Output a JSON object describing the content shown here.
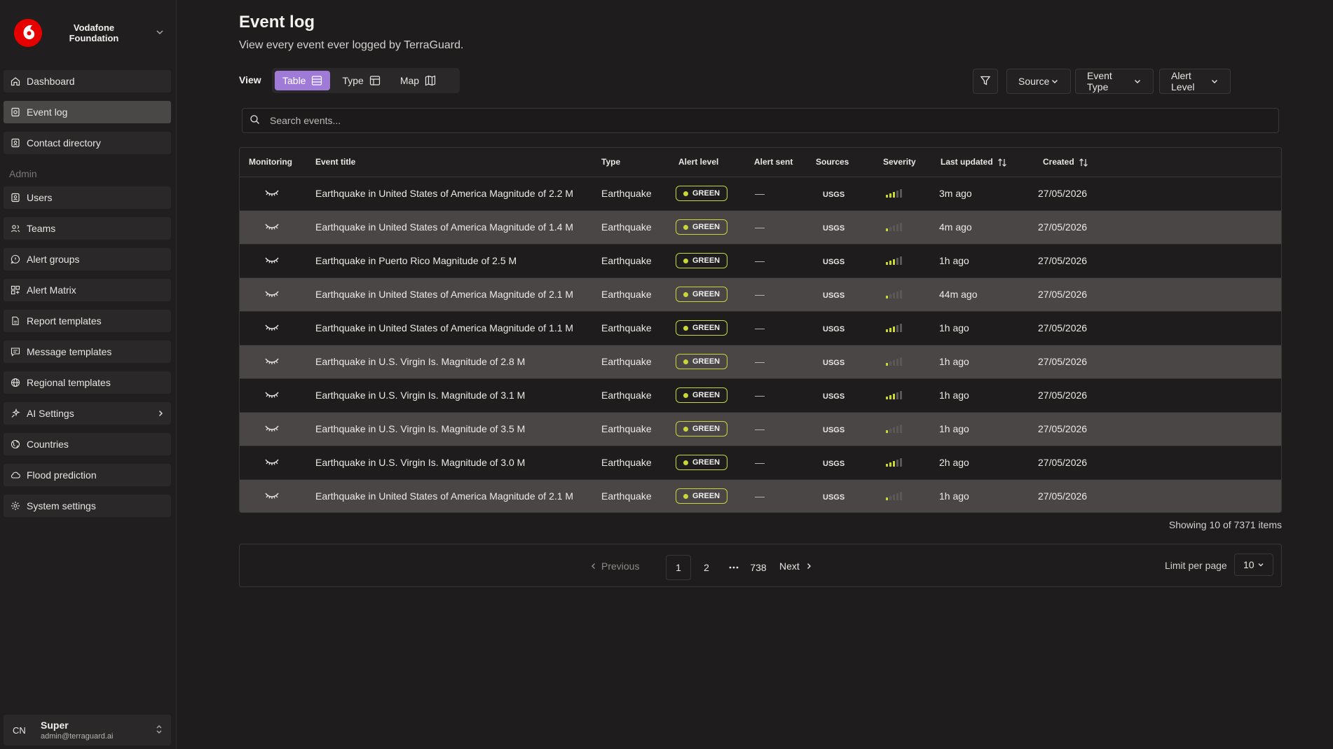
{
  "org": {
    "name": "Vodafone Foundation",
    "name_line1": "Vodafone",
    "name_line2": "Foundation",
    "brand_color": "#e60000"
  },
  "nav": {
    "items": [
      {
        "label": "Dashboard",
        "icon": "home-icon"
      },
      {
        "label": "Event log",
        "icon": "event-log-icon",
        "active": true
      },
      {
        "label": "Contact directory",
        "icon": "contact-icon"
      }
    ],
    "admin_label": "Admin",
    "admin_items": [
      {
        "label": "Users",
        "icon": "users-icon"
      },
      {
        "label": "Teams",
        "icon": "teams-icon"
      },
      {
        "label": "Alert groups",
        "icon": "alert-groups-icon"
      },
      {
        "label": "Alert Matrix",
        "icon": "matrix-icon"
      },
      {
        "label": "Report templates",
        "icon": "report-icon"
      },
      {
        "label": "Message templates",
        "icon": "message-icon"
      },
      {
        "label": "Regional templates",
        "icon": "globe-icon"
      },
      {
        "label": "AI Settings",
        "icon": "sparkle-icon"
      },
      {
        "label": "Countries",
        "icon": "countries-icon"
      },
      {
        "label": "Flood prediction",
        "icon": "cloud-icon"
      },
      {
        "label": "System settings",
        "icon": "gear-icon"
      }
    ]
  },
  "user": {
    "initials": "CN",
    "name": "Super",
    "email": "admin@terraguard.ai"
  },
  "page": {
    "title": "Event log",
    "subtitle": "View every event ever logged by TerraGuard."
  },
  "view": {
    "label": "View",
    "options": [
      {
        "label": "Table",
        "active": true
      },
      {
        "label": "Type"
      },
      {
        "label": "Map"
      }
    ],
    "accent": "#9f7ad6"
  },
  "filters": {
    "source": "Source",
    "event_type": "Event Type",
    "alert_level": "Alert Level"
  },
  "search": {
    "placeholder": "Search events..."
  },
  "table": {
    "columns": [
      "Monitoring",
      "Event title",
      "Type",
      "Alert level",
      "Alert sent",
      "Sources",
      "Severity",
      "Last updated",
      "Created"
    ],
    "rows": [
      {
        "title": "Earthquake in United States of America Magnitude of 2.2 M",
        "type": "Earthquake",
        "alert_level": "GREEN",
        "alert_sent": "—",
        "source": "USGS",
        "severity": 3,
        "last_updated": "3m ago",
        "created": "27/05/2026"
      },
      {
        "title": "Earthquake in United States of America Magnitude of 1.4 M",
        "type": "Earthquake",
        "alert_level": "GREEN",
        "alert_sent": "—",
        "source": "USGS",
        "severity": 1,
        "last_updated": "4m ago",
        "created": "27/05/2026"
      },
      {
        "title": "Earthquake in Puerto Rico Magnitude of 2.5 M",
        "type": "Earthquake",
        "alert_level": "GREEN",
        "alert_sent": "—",
        "source": "USGS",
        "severity": 3,
        "last_updated": "1h ago",
        "created": "27/05/2026"
      },
      {
        "title": "Earthquake in United States of America Magnitude of 2.1 M",
        "type": "Earthquake",
        "alert_level": "GREEN",
        "alert_sent": "—",
        "source": "USGS",
        "severity": 1,
        "last_updated": "44m ago",
        "created": "27/05/2026"
      },
      {
        "title": "Earthquake in United States of America Magnitude of 1.1 M",
        "type": "Earthquake",
        "alert_level": "GREEN",
        "alert_sent": "—",
        "source": "USGS",
        "severity": 3,
        "last_updated": "1h ago",
        "created": "27/05/2026"
      },
      {
        "title": "Earthquake in U.S. Virgin Is. Magnitude of 2.8 M",
        "type": "Earthquake",
        "alert_level": "GREEN",
        "alert_sent": "—",
        "source": "USGS",
        "severity": 1,
        "last_updated": "1h ago",
        "created": "27/05/2026"
      },
      {
        "title": "Earthquake in U.S. Virgin Is. Magnitude of 3.1 M",
        "type": "Earthquake",
        "alert_level": "GREEN",
        "alert_sent": "—",
        "source": "USGS",
        "severity": 3,
        "last_updated": "1h ago",
        "created": "27/05/2026"
      },
      {
        "title": "Earthquake in U.S. Virgin Is. Magnitude of 3.5 M",
        "type": "Earthquake",
        "alert_level": "GREEN",
        "alert_sent": "—",
        "source": "USGS",
        "severity": 1,
        "last_updated": "1h ago",
        "created": "27/05/2026"
      },
      {
        "title": "Earthquake in U.S. Virgin Is. Magnitude of 3.0 M",
        "type": "Earthquake",
        "alert_level": "GREEN",
        "alert_sent": "—",
        "source": "USGS",
        "severity": 3,
        "last_updated": "2h ago",
        "created": "27/05/2026"
      },
      {
        "title": "Earthquake in United States of America Magnitude of 2.1 M",
        "type": "Earthquake",
        "alert_level": "GREEN",
        "alert_sent": "—",
        "source": "USGS",
        "severity": 1,
        "last_updated": "1h ago",
        "created": "27/05/2026"
      }
    ],
    "alert_color": "#c8d63a"
  },
  "summary": {
    "showing": "Showing 10 of 7371 items"
  },
  "pagination": {
    "previous": "Previous",
    "next": "Next",
    "pages": [
      "1",
      "2",
      "...",
      "738"
    ],
    "current": "1",
    "limit_label": "Limit per page",
    "limit_value": "10"
  }
}
